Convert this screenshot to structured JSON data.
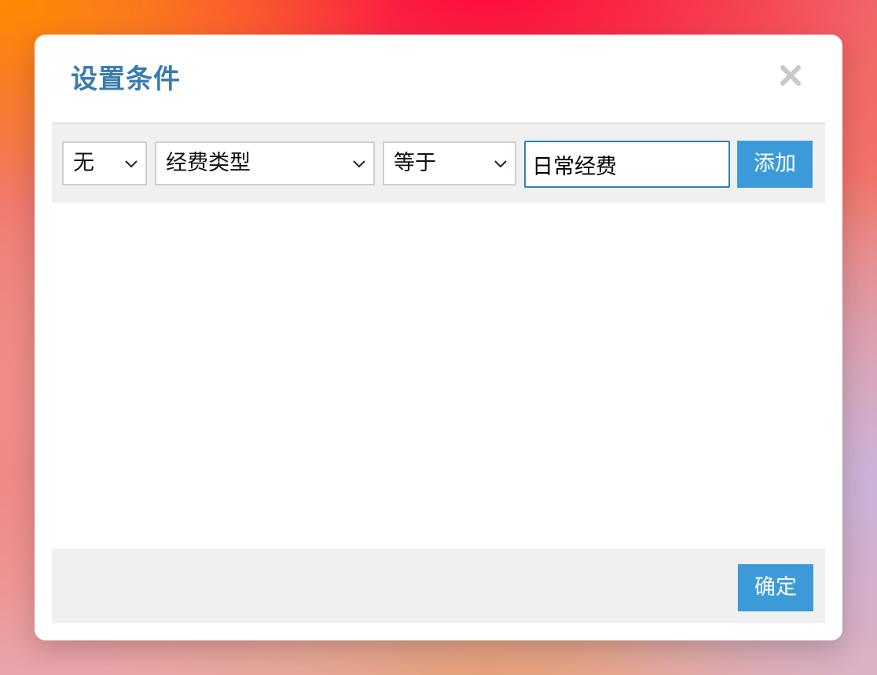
{
  "dialog": {
    "title": "设置条件",
    "close_icon": "close-icon"
  },
  "condition_row": {
    "logic_select": {
      "value": "无"
    },
    "field_select": {
      "value": "经费类型"
    },
    "operator_select": {
      "value": "等于"
    },
    "value_input": {
      "value": "日常经费"
    },
    "add_button": {
      "label": "添加"
    }
  },
  "footer": {
    "confirm_button": {
      "label": "确定"
    }
  },
  "colors": {
    "accent": "#3d9ad8",
    "title": "#3a7bb0",
    "panel_bg": "#f0f0f0"
  }
}
